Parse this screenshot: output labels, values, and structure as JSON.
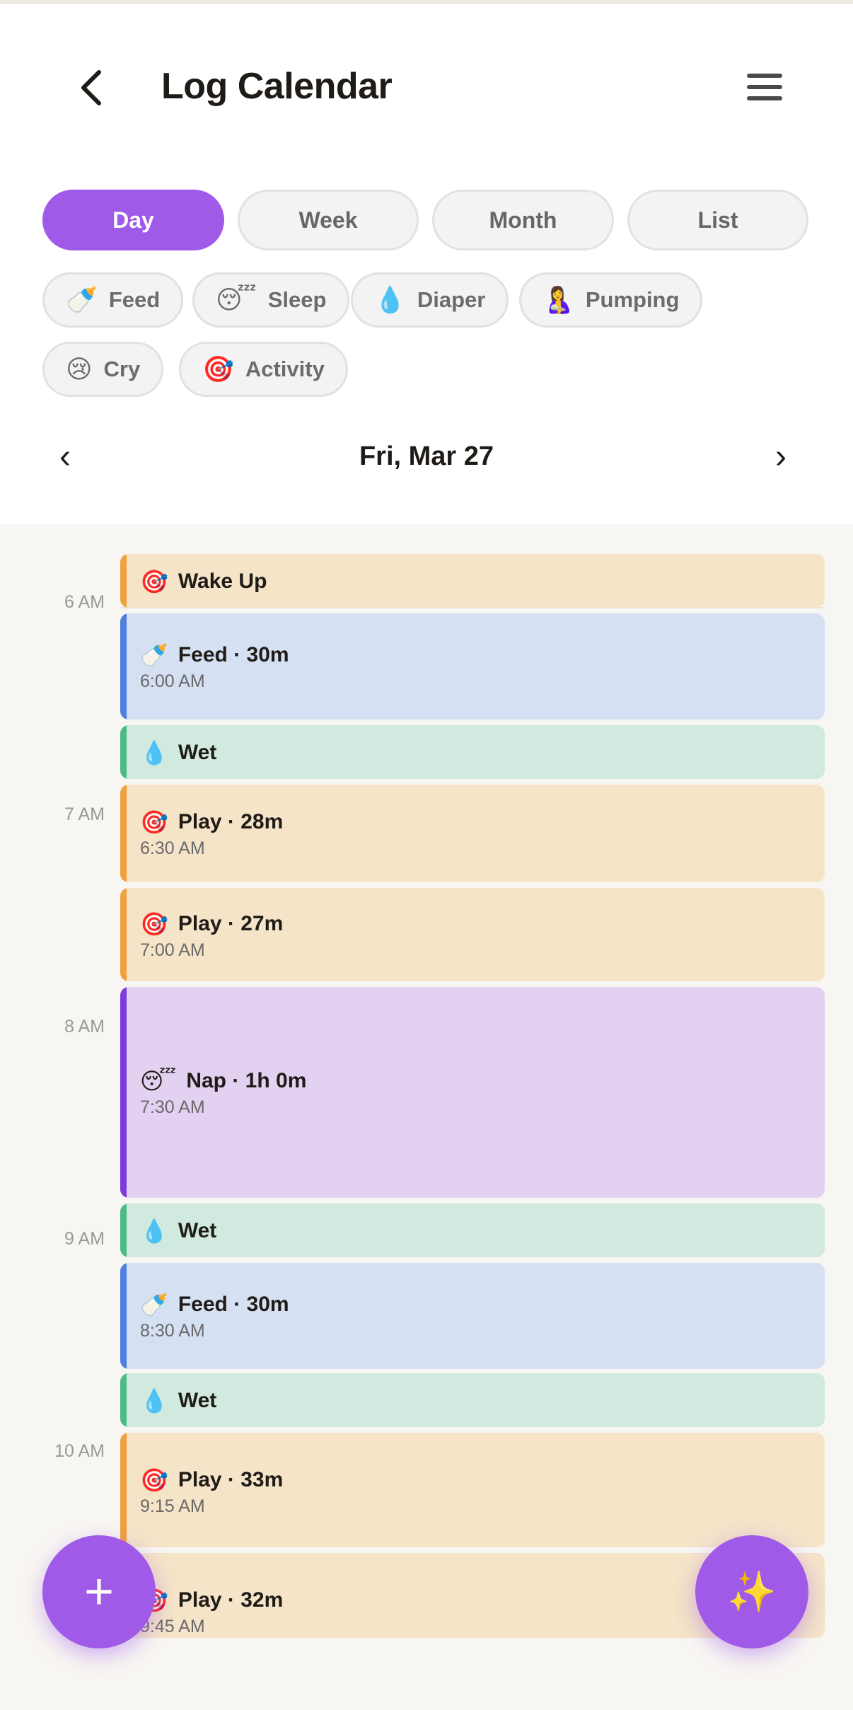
{
  "header": {
    "title": "Log Calendar",
    "back_icon": "chevron-left-icon",
    "menu_icon": "hamburger-menu-icon"
  },
  "view_tabs": [
    {
      "label": "Day",
      "selected": true
    },
    {
      "label": "Week",
      "selected": false
    },
    {
      "label": "Month",
      "selected": false
    },
    {
      "label": "List",
      "selected": false
    }
  ],
  "filters": [
    {
      "emoji": "🍼",
      "label": "Feed"
    },
    {
      "emoji": "😴",
      "label": "Sleep"
    },
    {
      "emoji": "💧",
      "label": "Diaper"
    },
    {
      "emoji": "🤱",
      "label": "Pumping"
    },
    {
      "emoji": "😢",
      "label": "Cry"
    },
    {
      "emoji": "🎯",
      "label": "Activity"
    }
  ],
  "date_nav": {
    "prev": "‹",
    "date": "Fri, Mar 27",
    "next": "›"
  },
  "hours": [
    "6 AM",
    "7 AM",
    "8 AM",
    "9 AM",
    "10 AM"
  ],
  "events": [
    {
      "emoji": "🎯",
      "title": "Wake Up",
      "time": ""
    },
    {
      "emoji": "🍼",
      "title": "Feed · 30m",
      "time": "6:00 AM"
    },
    {
      "emoji": "💧",
      "title": "Wet",
      "time": ""
    },
    {
      "emoji": "🎯",
      "title": "Play · 28m",
      "time": "6:30 AM"
    },
    {
      "emoji": "🎯",
      "title": "Play · 27m",
      "time": "7:00 AM"
    },
    {
      "emoji": "😴",
      "title": "Nap · 1h 0m",
      "time": "7:30 AM"
    },
    {
      "emoji": "💧",
      "title": "Wet",
      "time": ""
    },
    {
      "emoji": "🍼",
      "title": "Feed · 30m",
      "time": "8:30 AM"
    },
    {
      "emoji": "💧",
      "title": "Wet",
      "time": ""
    },
    {
      "emoji": "🎯",
      "title": "Play · 33m",
      "time": "9:15 AM"
    },
    {
      "emoji": "🎯",
      "title": "Play · 32m",
      "time": "9:45 AM"
    }
  ],
  "colors": {
    "accent": "#a05ae8",
    "activity_bg": "#f5e4c8",
    "activity_bar": "#f0a13c",
    "feed_bg": "#d5e0f2",
    "feed_bar": "#4f7fe0",
    "diaper_bg": "#d0eadf",
    "diaper_bar": "#4dbb86",
    "sleep_bg": "#e2d1f0",
    "sleep_bar": "#7d3be0"
  },
  "fab": {
    "add": "+",
    "add_icon": "plus-icon",
    "ai": "✨",
    "ai_icon": "sparkles-icon"
  }
}
